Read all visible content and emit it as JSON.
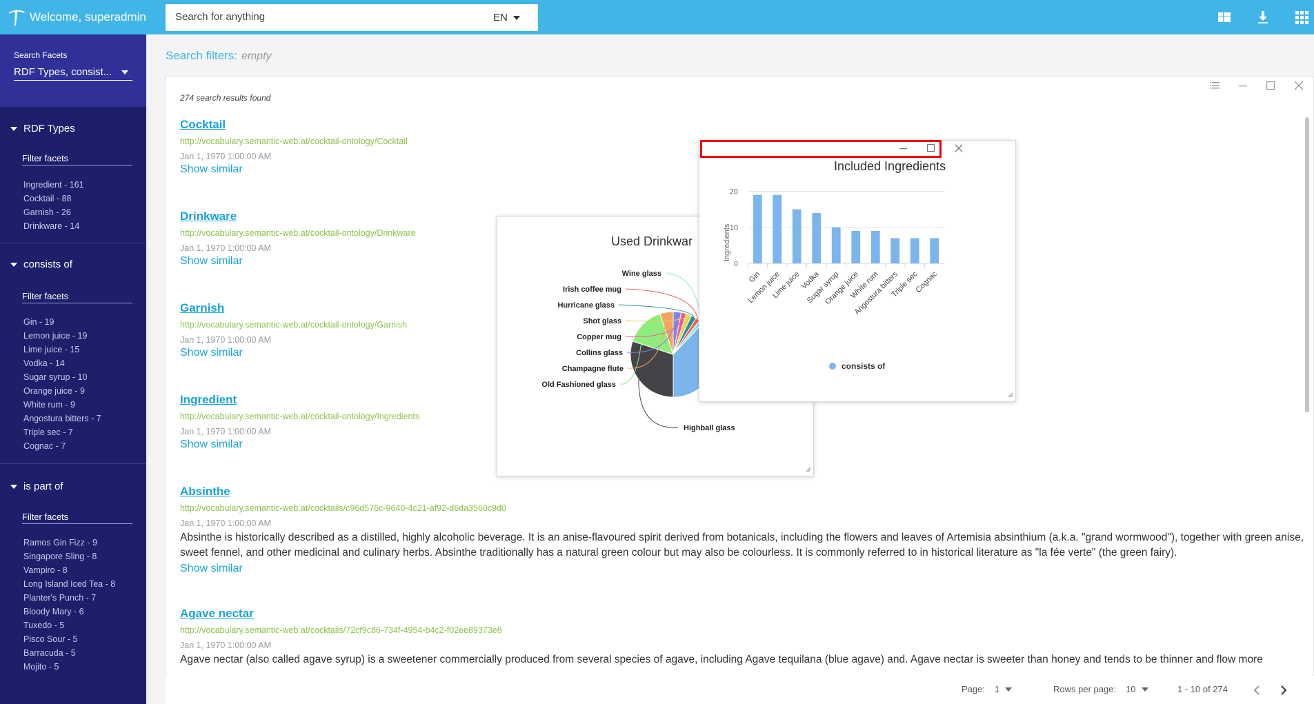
{
  "topbar": {
    "welcome": "Welcome, superadmin",
    "search_placeholder": "Search for anything",
    "language": "EN",
    "icons": [
      "dashboard-icon",
      "download-icon",
      "apps-grid-icon"
    ],
    "color": "#42b5e8"
  },
  "sidebar": {
    "facets_caption": "Search Facets",
    "facets_value": "RDF Types, consist...",
    "groups": [
      {
        "title": "RDF Types",
        "filter_label": "Filter facets",
        "items": [
          "Ingredient - 161",
          "Cocktail - 88",
          "Garnish - 26",
          "Drinkware - 14"
        ]
      },
      {
        "title": "consists of",
        "filter_label": "Filter facets",
        "items": [
          "Gin - 19",
          "Lemon juice - 19",
          "Lime juice - 15",
          "Vodka - 14",
          "Sugar syrup - 10",
          "Orange juice - 9",
          "White rum - 9",
          "Angostura bitters - 7",
          "Triple sec - 7",
          "Cognac - 7"
        ]
      },
      {
        "title": "is part of",
        "filter_label": "Filter facets",
        "items": [
          "Ramos Gin Fizz - 9",
          "Singapore Sling - 8",
          "Vampiro - 8",
          "Long Island Iced Tea - 8",
          "Planter's Punch - 7",
          "Bloody Mary - 6",
          "Tuxedo - 5",
          "Pisco Sour - 5",
          "Barracuda - 5",
          "Mojito - 5"
        ]
      }
    ]
  },
  "main": {
    "filters_label": "Search filters:",
    "filters_value": "empty",
    "results_count": "274 search results found",
    "results": [
      {
        "title": "Cocktail",
        "url": "http://vocabulary.semantic-web.at/cocktail-ontology/Cocktail",
        "date": "Jan 1, 1970 1:00:00 AM",
        "desc": "",
        "similar": "Show similar"
      },
      {
        "title": "Drinkware",
        "url": "http://vocabulary.semantic-web.at/cocktail-ontology/Drinkware",
        "date": "Jan 1, 1970 1:00:00 AM",
        "desc": "",
        "similar": "Show similar"
      },
      {
        "title": "Garnish",
        "url": "http://vocabulary.semantic-web.at/cocktail-ontology/Garnish",
        "date": "Jan 1, 1970 1:00:00 AM",
        "desc": "",
        "similar": "Show similar"
      },
      {
        "title": "Ingredient",
        "url": "http://vocabulary.semantic-web.at/cocktail-ontology/Ingredients",
        "date": "Jan 1, 1970 1:00:00 AM",
        "desc": "",
        "similar": "Show similar"
      },
      {
        "title": "Absinthe",
        "url": "http://vocabulary.semantic-web.at/cocktails/c96d576c-9640-4c21-af92-d6da3560c9d0",
        "date": "Jan 1, 1970 1:00:00 AM",
        "desc": "Absinthe is historically described as a distilled, highly alcoholic beverage. It is an anise-flavoured spirit derived from botanicals, including the flowers and leaves of Artemisia absinthium (a.k.a. \"grand wormwood\"), together with green anise, sweet fennel, and other medicinal and culinary herbs. Absinthe traditionally has a natural green colour but may also be colourless. It is commonly referred to in historical literature as \"la fée verte\" (the green fairy).",
        "similar": "Show similar"
      },
      {
        "title": "Agave nectar",
        "url": "http://vocabulary.semantic-web.at/cocktails/72cf9c86-734f-4954-b4c2-f02ee89373e8",
        "date": "Jan 1, 1970 1:00:00 AM",
        "desc": "Agave nectar (also called agave syrup) is a sweetener commercially produced from several species of agave, including Agave tequilana (blue agave) and. Agave nectar is sweeter than honey and tends to be thinner and flow more",
        "similar": ""
      }
    ]
  },
  "pager": {
    "page_label": "Page:",
    "page_value": "1",
    "rows_label": "Rows per page:",
    "rows_value": "10",
    "range": "1 - 10 of 274"
  },
  "chart_data": [
    {
      "type": "pie",
      "title": "Used Drinkwar",
      "slices": [
        {
          "label": "Highball glass",
          "value": 30,
          "color": "#434348"
        },
        {
          "label": "Old Fashioned glass",
          "value": 15,
          "color": "#90ed7d"
        },
        {
          "label": "Champagne flute",
          "value": 5,
          "color": "#f7a35c"
        },
        {
          "label": "Collins glass",
          "value": 3,
          "color": "#8085e9"
        },
        {
          "label": "Copper mug",
          "value": 2,
          "color": "#f15c80"
        },
        {
          "label": "Shot glass",
          "value": 2,
          "color": "#e4d354"
        },
        {
          "label": "Hurricane glass",
          "value": 2,
          "color": "#2b908f"
        },
        {
          "label": "Irish coffee mug",
          "value": 1.5,
          "color": "#f45b5b"
        },
        {
          "label": "Wine glass",
          "value": 1.5,
          "color": "#91e8e1"
        },
        {
          "label": "",
          "value": 38,
          "color": "#7cb5ec"
        }
      ]
    },
    {
      "type": "bar",
      "title": "Included Ingredients",
      "categories": [
        "Gin",
        "Lemon juice",
        "Lime juice",
        "Vodka",
        "Sugar syrup",
        "Orange juice",
        "White rum",
        "Angostura bitters",
        "Triple sec",
        "Cognac"
      ],
      "series": [
        {
          "name": "consists of",
          "values": [
            19,
            19,
            15,
            14,
            10,
            9,
            9,
            7,
            7,
            7
          ],
          "color": "#7cb5ec"
        }
      ],
      "ylabel": "Ingredients",
      "ylim": [
        0,
        22
      ],
      "yticks": [
        0,
        10,
        20
      ],
      "grid": true,
      "legend": "bottom-center"
    }
  ]
}
